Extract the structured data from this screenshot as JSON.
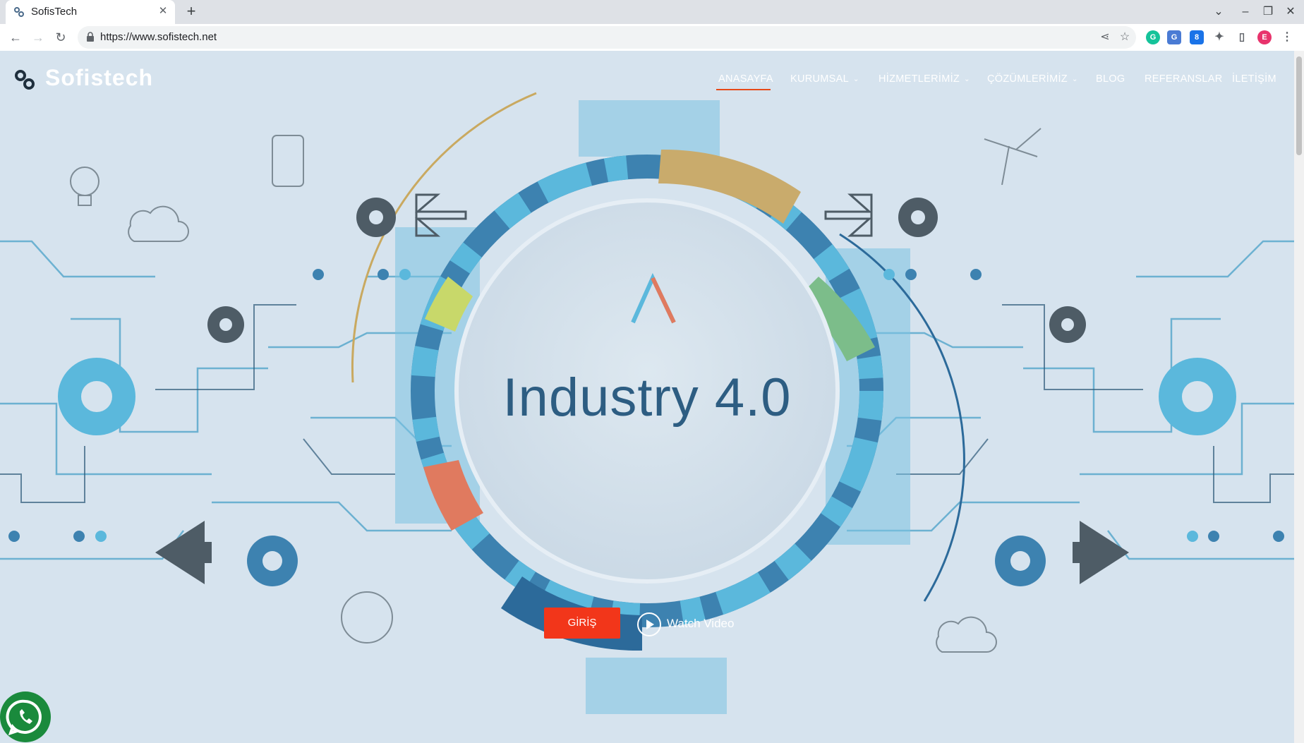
{
  "browser": {
    "tab_title": "SofisTech",
    "tab_close": "✕",
    "new_tab": "+",
    "url": "https://www.sofistech.net",
    "profile_initial": "E",
    "extension_badge": "8"
  },
  "site": {
    "logo_text": "Sofistech",
    "nav": [
      {
        "label": "ANASAYFA",
        "active": true
      },
      {
        "label": "KURUMSAL",
        "dropdown": true
      },
      {
        "label": "HİZMETLERİMİZ",
        "dropdown": true
      },
      {
        "label": "ÇÖZÜMLERİMİZ",
        "dropdown": true
      },
      {
        "label": "BLOG"
      },
      {
        "label": "REFERANSLAR"
      },
      {
        "label": "İLETİŞİM"
      }
    ],
    "hero": {
      "headline": "Industry 4.0",
      "cta_label": "GİRİŞ",
      "watch_label": "Watch Video"
    },
    "whatsapp_icon": "whatsapp-icon"
  },
  "colors": {
    "accent": "#f2361a",
    "hero_bg": "#d6e3ee",
    "ring_dark": "#2f6690",
    "ring_light": "#5bb8dc"
  }
}
